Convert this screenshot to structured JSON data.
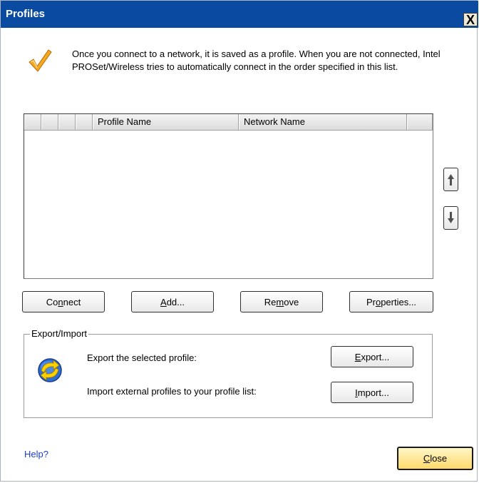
{
  "window": {
    "title": "Profiles",
    "close_glyph": "X"
  },
  "intro_text": "Once you connect to a network, it is saved as a profile. When you are not connected, Intel PROSet/Wireless tries to automatically connect in the order specified in this list.",
  "profile_list": {
    "columns": [
      "",
      "",
      "",
      "",
      "Profile Name",
      "Network Name",
      ""
    ],
    "rows": []
  },
  "buttons": {
    "connect": {
      "pre": "Co",
      "u": "n",
      "post": "nect"
    },
    "add": {
      "pre": "",
      "u": "A",
      "post": "dd..."
    },
    "remove": {
      "pre": "Re",
      "u": "m",
      "post": "ove"
    },
    "properties": {
      "pre": "Pr",
      "u": "o",
      "post": "perties..."
    }
  },
  "export_import": {
    "group_label": "Export/Import",
    "export_text": "Export the selected profile:",
    "import_text": "Import external profiles to your profile list:",
    "export_button": {
      "pre": "",
      "u": "E",
      "post": "xport..."
    },
    "import_button": {
      "pre": "",
      "u": "I",
      "post": "mport..."
    }
  },
  "help_link": "Help?",
  "close_button": {
    "pre": "",
    "u": "C",
    "post": "lose"
  },
  "icons": {
    "check": "check-mark-icon",
    "sync": "sync-arrows-icon",
    "up": "arrow-up-icon",
    "down": "arrow-down-icon"
  },
  "colors": {
    "titlebar": "#0a4aa0",
    "link": "#1a3fc8",
    "close_button": "#ffd86a"
  }
}
